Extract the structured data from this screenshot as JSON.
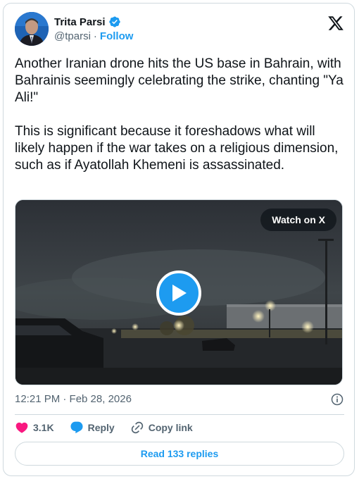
{
  "author": {
    "name": "Trita Parsi",
    "handle": "@tparsi",
    "follow_label": "Follow",
    "separator": "·",
    "verified": true
  },
  "tweet": {
    "text": "Another Iranian drone hits the US base in Bahrain, with  Bahrainis seemingly celebrating the strike, chanting \"Ya Ali!\"\n\nThis is significant because it foreshadows what will likely happen if the war takes on a religious dimension, such as if Ayatollah Khemeni is assassinated."
  },
  "media": {
    "watch_label": "Watch on X",
    "play_icon": "play-icon"
  },
  "meta": {
    "timestamp": "12:21 PM · Feb 28, 2026"
  },
  "actions": {
    "likes_count": "3.1K",
    "reply_label": "Reply",
    "copy_link_label": "Copy link"
  },
  "replies_button_label": "Read 133 replies",
  "colors": {
    "accent": "#1d9bf0",
    "like": "#f91880",
    "secondary_text": "#536471",
    "border": "#cfd9de"
  }
}
